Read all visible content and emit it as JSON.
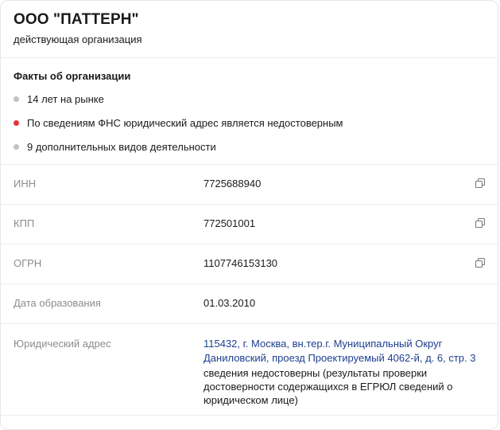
{
  "company": {
    "name": "ООО \"ПАТТЕРН\"",
    "status": "действующая организация"
  },
  "facts": {
    "title": "Факты об организации",
    "items": [
      {
        "text": "14 лет на рынке",
        "dot_color": "#c2c2c2"
      },
      {
        "text": "По сведениям ФНС юридический адрес является недостоверным",
        "dot_color": "#e5343b"
      },
      {
        "text": "9 дополнительных видов деятельности",
        "dot_color": "#c2c2c2"
      }
    ]
  },
  "details": {
    "inn": {
      "label": "ИНН",
      "value": "7725688940",
      "icon": "copy-icon"
    },
    "kpp": {
      "label": "КПП",
      "value": "772501001",
      "icon": "copy-icon"
    },
    "ogrn": {
      "label": "ОГРН",
      "value": "1107746153130",
      "icon": "copy-icon"
    },
    "founded": {
      "label": "Дата образования",
      "value": "01.03.2010"
    },
    "address": {
      "label": "Юридический адрес",
      "value": "115432, г. Москва, вн.тер.г. Муниципальный Округ Даниловский, проезд Проектируемый 4062-й, д. 6, стр. 3",
      "note": "сведения недостоверны (результаты проверки достоверности содержащихся в ЕГРЮЛ сведений о юридическом лице)"
    }
  },
  "colors": {
    "link": "#1d3f8f",
    "label": "#8c8c8c",
    "warning_dot": "#e5343b",
    "neutral_dot": "#c2c2c2"
  }
}
